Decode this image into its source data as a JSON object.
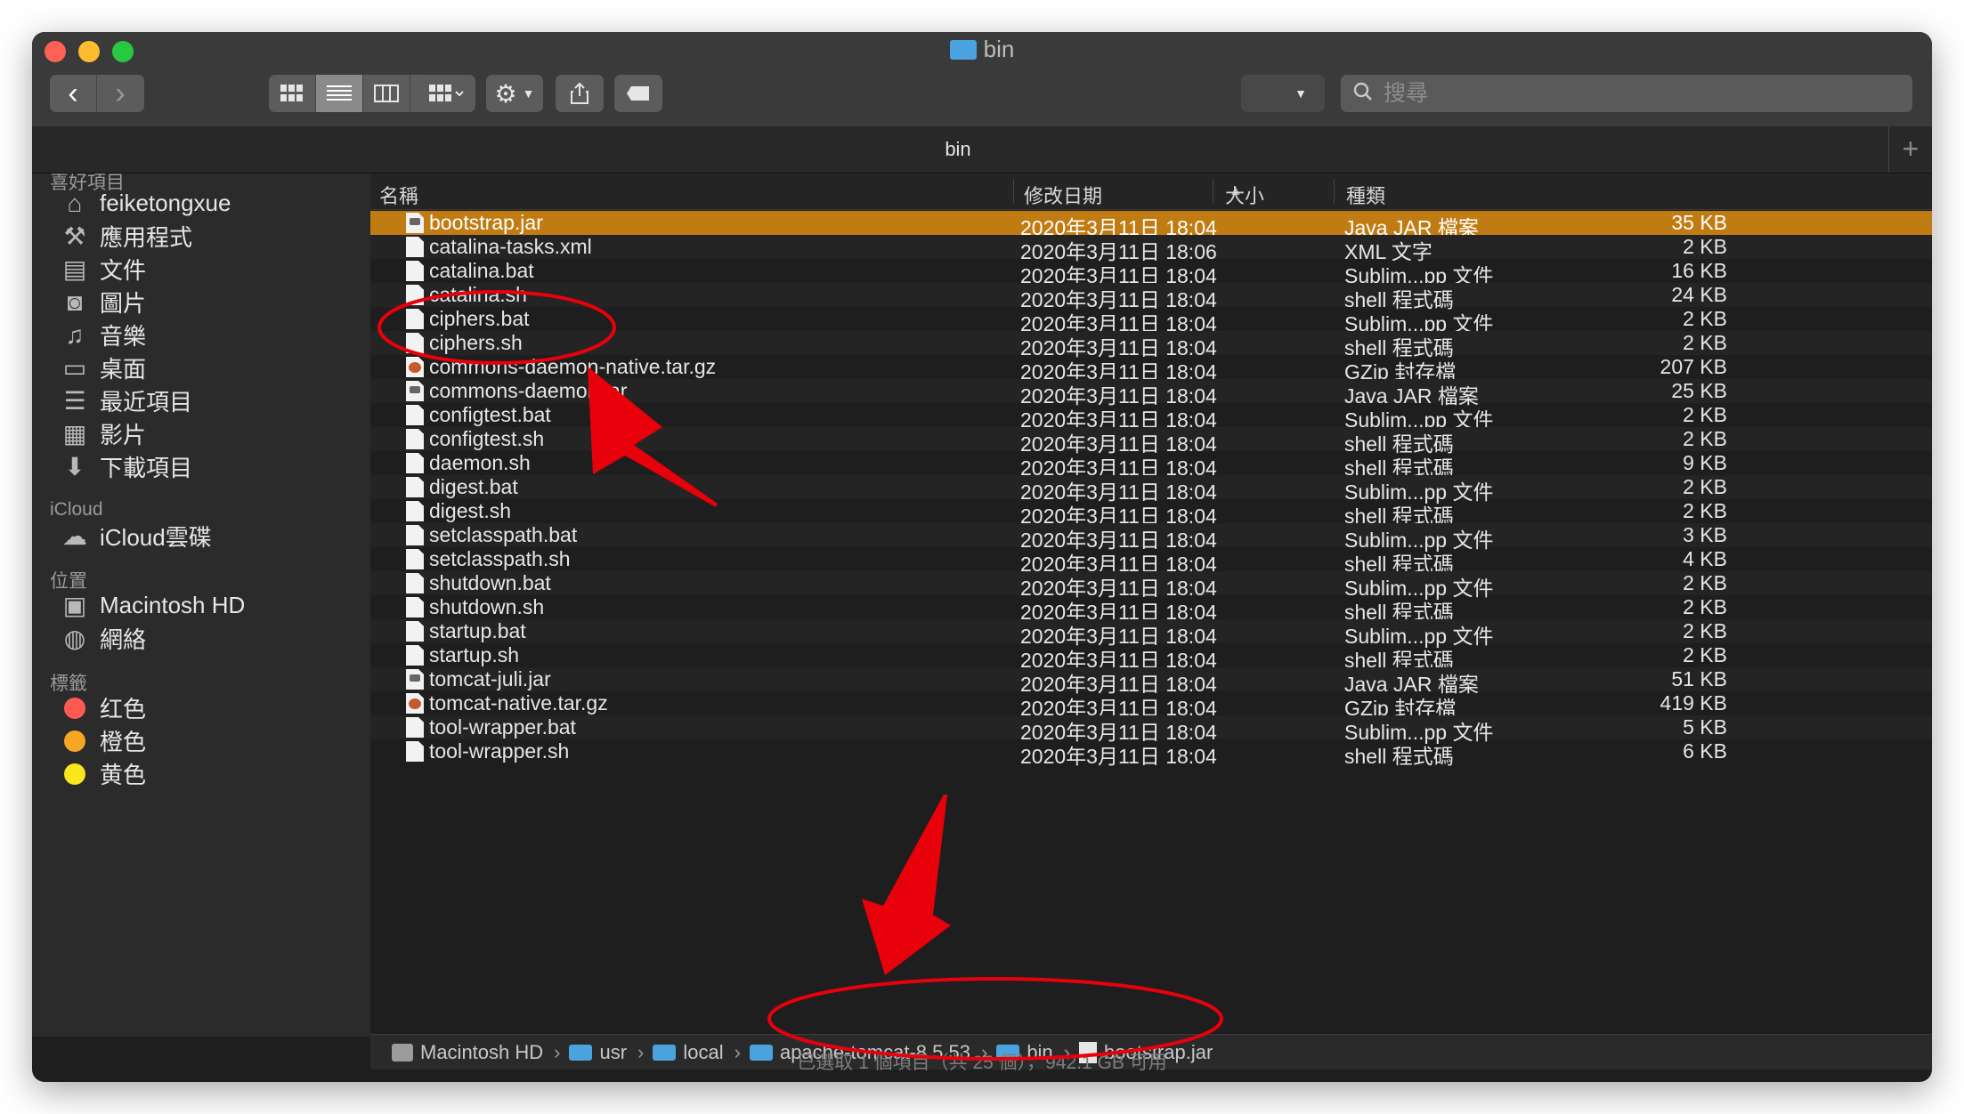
{
  "window": {
    "title": "bin"
  },
  "toolbar": {
    "search_placeholder": "搜尋",
    "back_label": "‹",
    "forward_label": "›"
  },
  "tab": {
    "label": "bin",
    "add_label": "+"
  },
  "sidebar": {
    "favorites_header": "喜好項目",
    "favorites": [
      {
        "label": "feiketongxue",
        "icon": "home-icon"
      },
      {
        "label": "應用程式",
        "icon": "applications-icon"
      },
      {
        "label": "文件",
        "icon": "documents-icon"
      },
      {
        "label": "圖片",
        "icon": "pictures-icon"
      },
      {
        "label": "音樂",
        "icon": "music-icon"
      },
      {
        "label": "桌面",
        "icon": "desktop-icon"
      },
      {
        "label": "最近項目",
        "icon": "recents-icon"
      },
      {
        "label": "影片",
        "icon": "movies-icon"
      },
      {
        "label": "下載項目",
        "icon": "downloads-icon"
      }
    ],
    "icloud_header": "iCloud",
    "icloud": [
      {
        "label": "iCloud雲碟",
        "icon": "cloud-icon"
      }
    ],
    "locations_header": "位置",
    "locations": [
      {
        "label": "Macintosh HD",
        "icon": "disk-icon"
      },
      {
        "label": "網絡",
        "icon": "network-icon"
      }
    ],
    "tags_header": "標籤",
    "tags": [
      {
        "label": "红色",
        "color": "#ff5a52"
      },
      {
        "label": "橙色",
        "color": "#f5a623"
      },
      {
        "label": "黄色",
        "color": "#f8e71c"
      }
    ]
  },
  "columns": {
    "name": "名稱",
    "date": "修改日期",
    "size": "大小",
    "kind": "種類"
  },
  "files": [
    {
      "name": "bootstrap.jar",
      "date": "2020年3月11日 18:04",
      "size": "35 KB",
      "kind": "Java JAR 檔案",
      "type": "jar",
      "selected": true
    },
    {
      "name": "catalina-tasks.xml",
      "date": "2020年3月11日 18:06",
      "size": "2 KB",
      "kind": "XML 文字",
      "type": "doc"
    },
    {
      "name": "catalina.bat",
      "date": "2020年3月11日 18:04",
      "size": "16 KB",
      "kind": "Sublim...pp 文件",
      "type": "doc"
    },
    {
      "name": "catalina.sh",
      "date": "2020年3月11日 18:04",
      "size": "24 KB",
      "kind": "shell 程式碼",
      "type": "doc"
    },
    {
      "name": "ciphers.bat",
      "date": "2020年3月11日 18:04",
      "size": "2 KB",
      "kind": "Sublim...pp 文件",
      "type": "doc"
    },
    {
      "name": "ciphers.sh",
      "date": "2020年3月11日 18:04",
      "size": "2 KB",
      "kind": "shell 程式碼",
      "type": "doc"
    },
    {
      "name": "commons-daemon-native.tar.gz",
      "date": "2020年3月11日 18:04",
      "size": "207 KB",
      "kind": "GZip 封存檔",
      "type": "gz"
    },
    {
      "name": "commons-daemon.jar",
      "date": "2020年3月11日 18:04",
      "size": "25 KB",
      "kind": "Java JAR 檔案",
      "type": "jar"
    },
    {
      "name": "configtest.bat",
      "date": "2020年3月11日 18:04",
      "size": "2 KB",
      "kind": "Sublim...pp 文件",
      "type": "doc"
    },
    {
      "name": "configtest.sh",
      "date": "2020年3月11日 18:04",
      "size": "2 KB",
      "kind": "shell 程式碼",
      "type": "doc"
    },
    {
      "name": "daemon.sh",
      "date": "2020年3月11日 18:04",
      "size": "9 KB",
      "kind": "shell 程式碼",
      "type": "doc"
    },
    {
      "name": "digest.bat",
      "date": "2020年3月11日 18:04",
      "size": "2 KB",
      "kind": "Sublim...pp 文件",
      "type": "doc"
    },
    {
      "name": "digest.sh",
      "date": "2020年3月11日 18:04",
      "size": "2 KB",
      "kind": "shell 程式碼",
      "type": "doc"
    },
    {
      "name": "setclasspath.bat",
      "date": "2020年3月11日 18:04",
      "size": "3 KB",
      "kind": "Sublim...pp 文件",
      "type": "doc"
    },
    {
      "name": "setclasspath.sh",
      "date": "2020年3月11日 18:04",
      "size": "4 KB",
      "kind": "shell 程式碼",
      "type": "doc"
    },
    {
      "name": "shutdown.bat",
      "date": "2020年3月11日 18:04",
      "size": "2 KB",
      "kind": "Sublim...pp 文件",
      "type": "doc"
    },
    {
      "name": "shutdown.sh",
      "date": "2020年3月11日 18:04",
      "size": "2 KB",
      "kind": "shell 程式碼",
      "type": "doc"
    },
    {
      "name": "startup.bat",
      "date": "2020年3月11日 18:04",
      "size": "2 KB",
      "kind": "Sublim...pp 文件",
      "type": "doc"
    },
    {
      "name": "startup.sh",
      "date": "2020年3月11日 18:04",
      "size": "2 KB",
      "kind": "shell 程式碼",
      "type": "doc"
    },
    {
      "name": "tomcat-juli.jar",
      "date": "2020年3月11日 18:04",
      "size": "51 KB",
      "kind": "Java JAR 檔案",
      "type": "jar"
    },
    {
      "name": "tomcat-native.tar.gz",
      "date": "2020年3月11日 18:04",
      "size": "419 KB",
      "kind": "GZip 封存檔",
      "type": "gz"
    },
    {
      "name": "tool-wrapper.bat",
      "date": "2020年3月11日 18:04",
      "size": "5 KB",
      "kind": "Sublim...pp 文件",
      "type": "doc"
    },
    {
      "name": "tool-wrapper.sh",
      "date": "2020年3月11日 18:04",
      "size": "6 KB",
      "kind": "shell 程式碼",
      "type": "doc"
    }
  ],
  "pathbar": {
    "segments": [
      {
        "label": "Macintosh HD",
        "icon": "disk-icon"
      },
      {
        "label": "usr",
        "icon": "folder-icon"
      },
      {
        "label": "local",
        "icon": "folder-icon"
      },
      {
        "label": "apache-tomcat-8.5.53",
        "icon": "folder-icon"
      },
      {
        "label": "bin",
        "icon": "folder-icon"
      },
      {
        "label": "bootstrap.jar",
        "icon": "jar-icon"
      }
    ]
  },
  "status": "已選取 1 個項目（共 25 個），942.1 GB 可用",
  "colors": {
    "selection": "#c07c12",
    "annotation": "#e8000b",
    "accent_folder": "#4aa3df"
  }
}
